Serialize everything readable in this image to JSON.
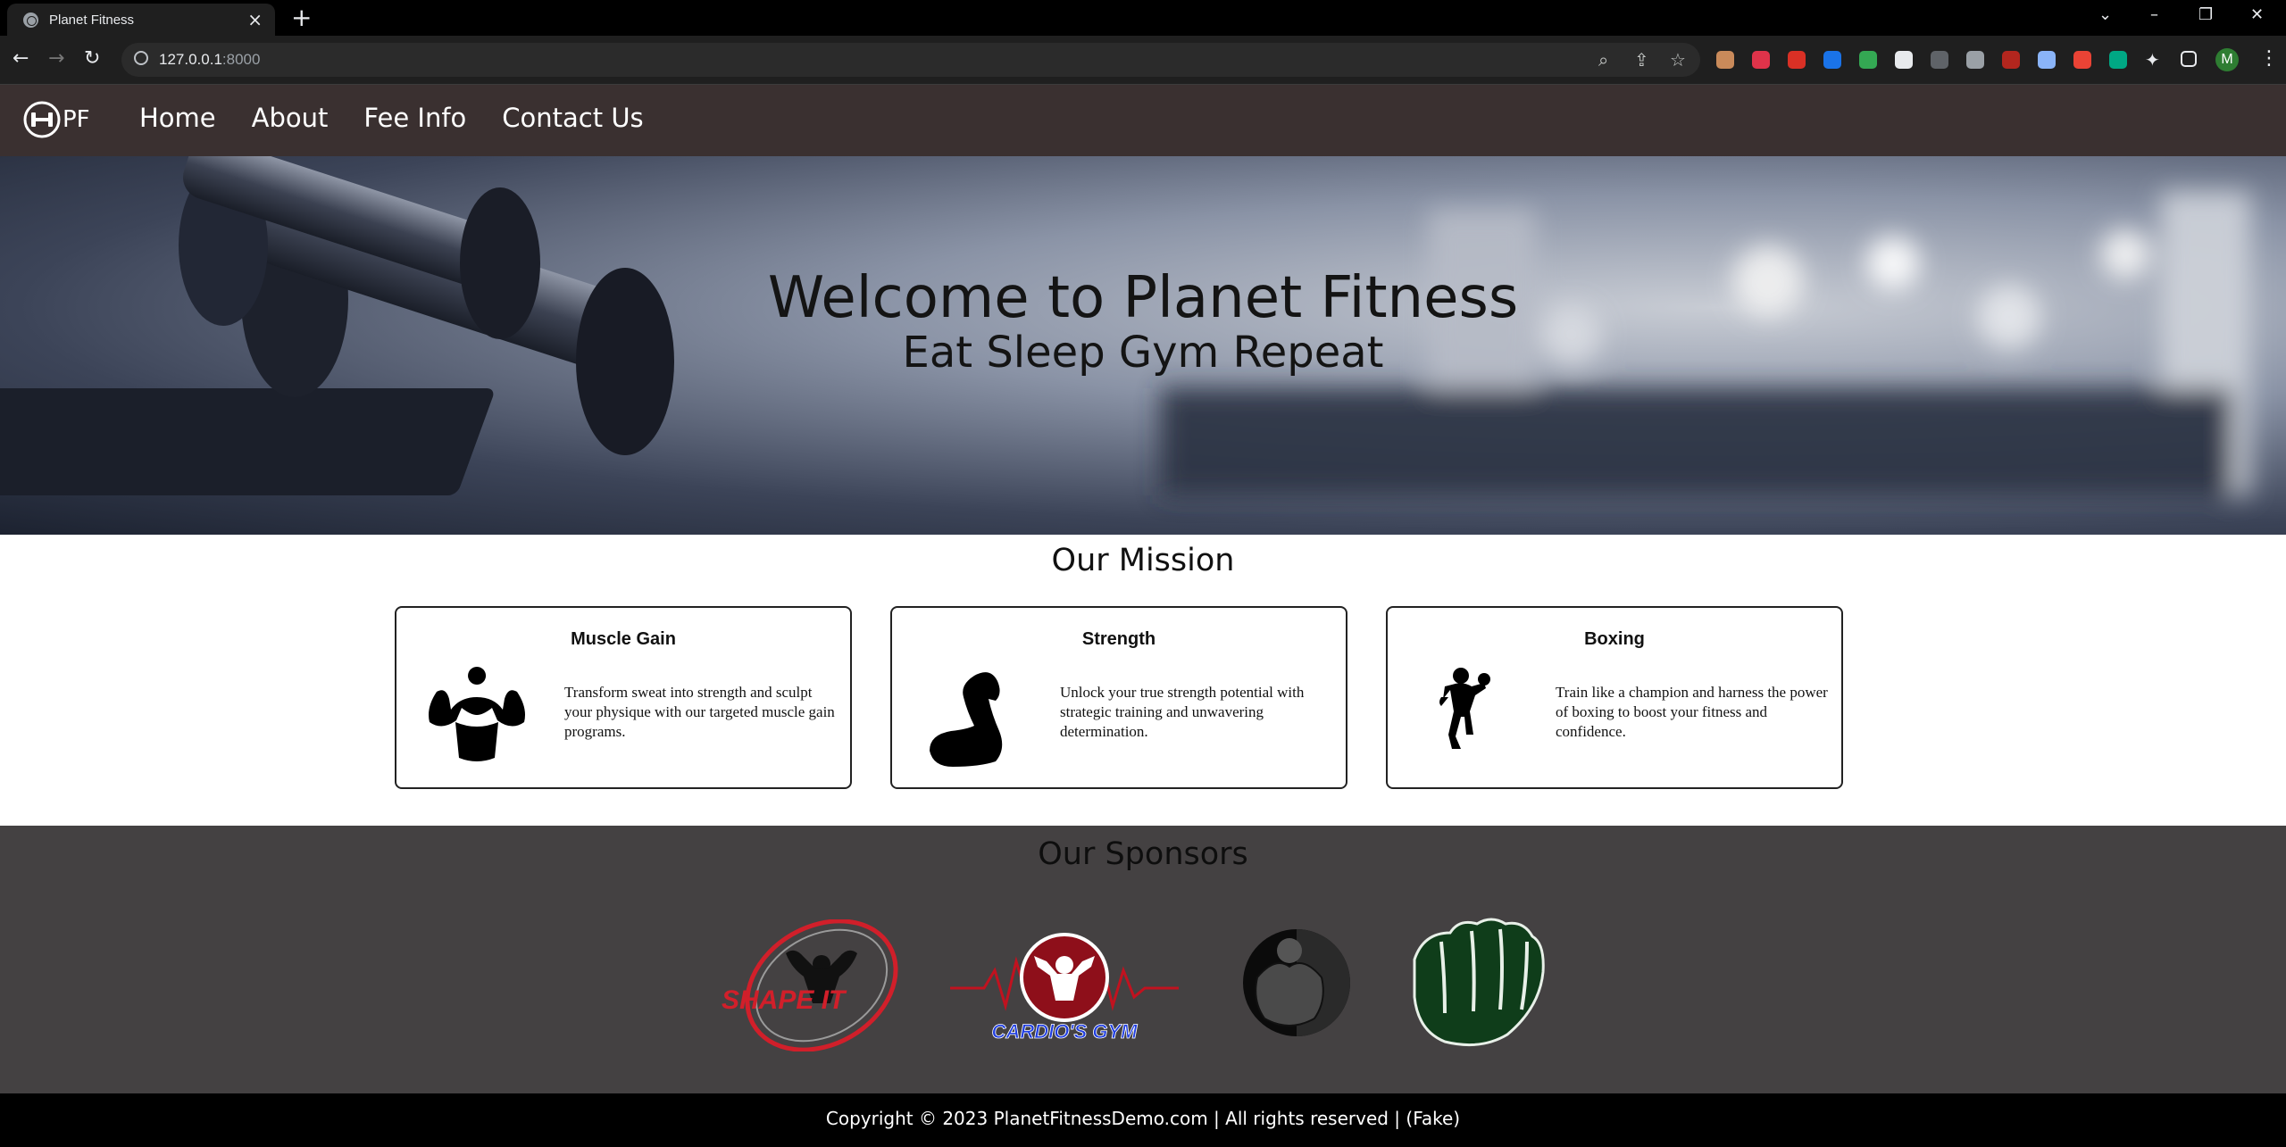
{
  "browser": {
    "tab_title": "Planet Fitness",
    "url_host": "127.0.0.1",
    "url_port": ":8000"
  },
  "site": {
    "logo_text": "PF",
    "nav": [
      "Home",
      "About",
      "Fee Info",
      "Contact Us"
    ]
  },
  "hero": {
    "title": "Welcome to Planet Fitness",
    "subtitle": "Eat Sleep Gym Repeat"
  },
  "mission": {
    "title": "Our Mission",
    "cards": [
      {
        "title": "Muscle Gain",
        "icon": "bodybuilder-icon",
        "text": "Transform sweat into strength and sculpt your physique with our targeted muscle gain programs."
      },
      {
        "title": "Strength",
        "icon": "flexed-arm-icon",
        "text": "Unlock your true strength potential with strategic training and unwavering determination."
      },
      {
        "title": "Boxing",
        "icon": "boxer-icon",
        "text": "Train like a champion and harness the power of boxing to boost your fitness and confidence."
      }
    ]
  },
  "sponsors": {
    "title": "Our Sponsors",
    "logos": [
      {
        "name": "shape-it-logo",
        "text": "SHAPE IT"
      },
      {
        "name": "cardios-gym-logo",
        "text": "CARDIO'S GYM"
      },
      {
        "name": "bodybuilder-circle-logo",
        "text": ""
      },
      {
        "name": "green-fist-logo",
        "text": ""
      }
    ]
  },
  "footer": {
    "text": "Copyright © 2023 PlanetFitnessDemo.com | All rights reserved | (Fake)"
  }
}
